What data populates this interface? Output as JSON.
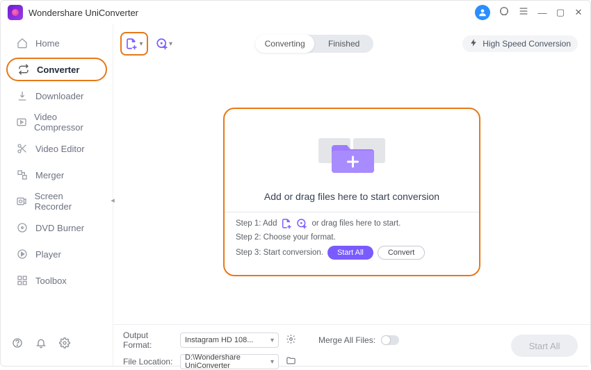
{
  "app": {
    "title": "Wondershare UniConverter"
  },
  "sidebar": {
    "items": [
      {
        "label": "Home"
      },
      {
        "label": "Converter"
      },
      {
        "label": "Downloader"
      },
      {
        "label": "Video Compressor"
      },
      {
        "label": "Video Editor"
      },
      {
        "label": "Merger"
      },
      {
        "label": "Screen Recorder"
      },
      {
        "label": "DVD Burner"
      },
      {
        "label": "Player"
      },
      {
        "label": "Toolbox"
      }
    ]
  },
  "segmented": {
    "converting": "Converting",
    "finished": "Finished"
  },
  "toolbar": {
    "high_speed": "High Speed Conversion"
  },
  "dropzone": {
    "message": "Add or drag files here to start conversion",
    "step1_prefix": "Step 1: Add",
    "step1_suffix": "or drag files here to start.",
    "step2": "Step 2: Choose your format.",
    "step3": "Step 3: Start conversion.",
    "start_all": "Start All",
    "convert": "Convert"
  },
  "footer": {
    "output_format_label": "Output Format:",
    "output_format_value": "Instagram HD 108...",
    "file_location_label": "File Location:",
    "file_location_value": "D:\\Wondershare UniConverter",
    "merge_label": "Merge All Files:",
    "start_all_big": "Start All"
  }
}
